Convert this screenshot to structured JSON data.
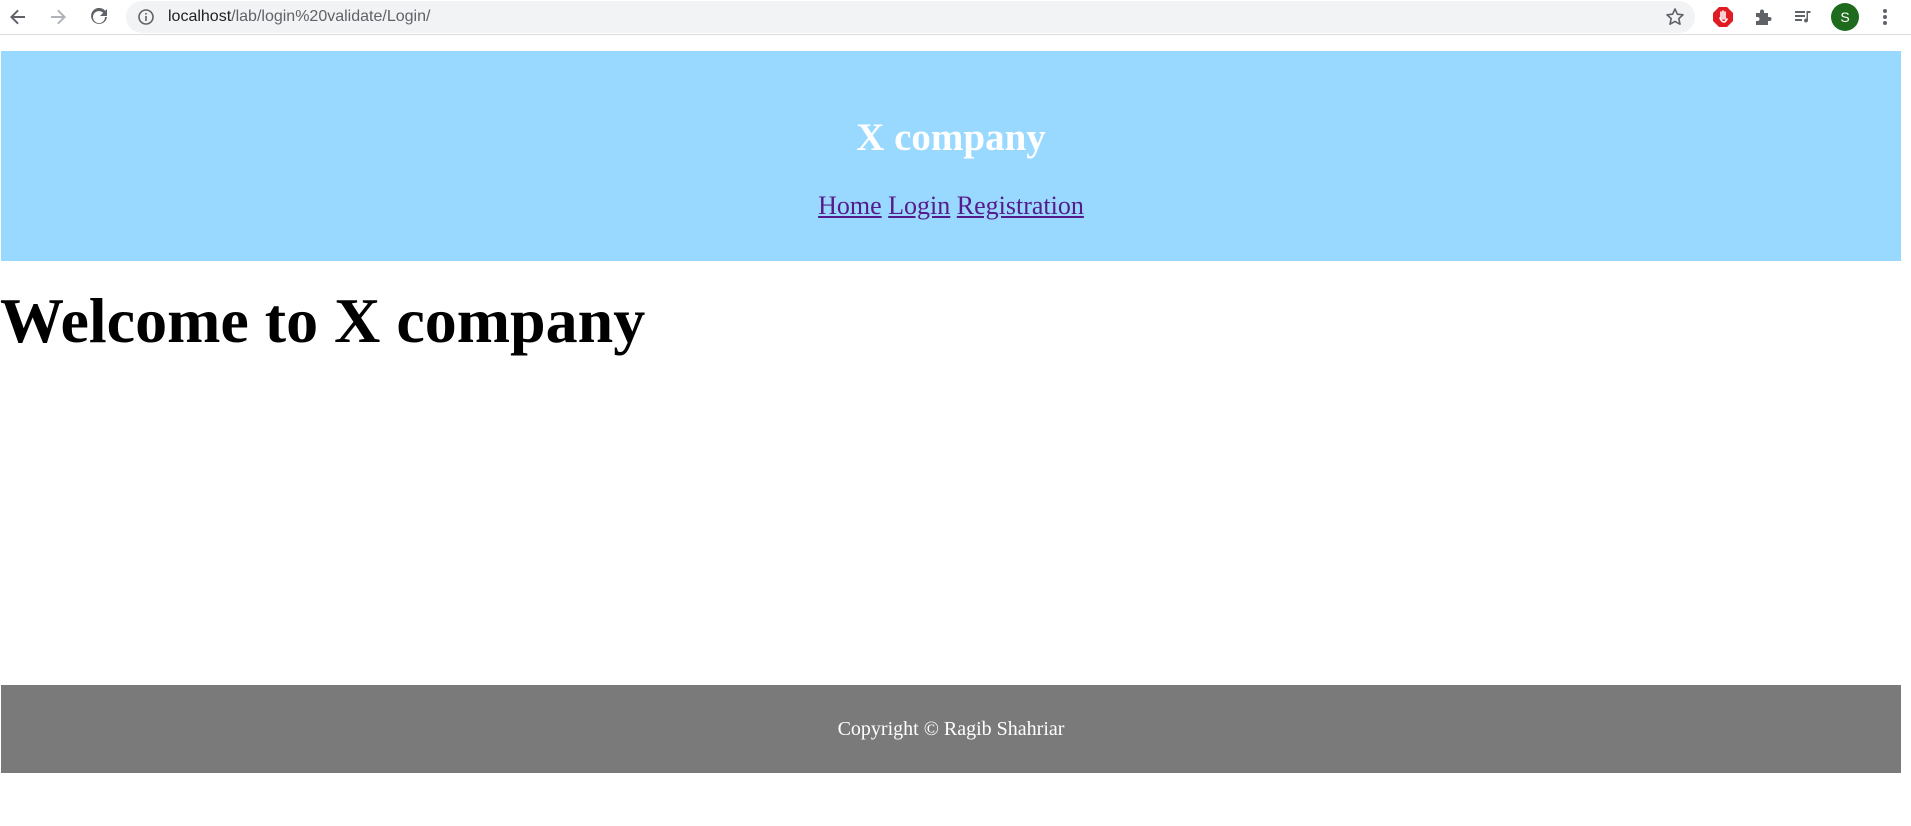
{
  "browser": {
    "url_host": "localhost",
    "url_path": "/lab/login%20validate/Login/",
    "profile_initial": "S"
  },
  "header": {
    "title": "X company",
    "nav": [
      "Home",
      "Login",
      "Registration"
    ]
  },
  "main": {
    "heading": "Welcome to X company"
  },
  "footer": {
    "text": "Copyright © Ragib Shahriar"
  },
  "colors": {
    "header_bg": "#99d9ff",
    "footer_bg": "#7a7a7a",
    "link": "#551a8b",
    "avatar": "#1e6b1e"
  },
  "icons": [
    "back-arrow-icon",
    "forward-arrow-icon",
    "reload-icon",
    "info-icon",
    "star-icon",
    "adblock-icon",
    "extensions-puzzle-icon",
    "media-queue-icon",
    "kebab-menu-icon"
  ]
}
